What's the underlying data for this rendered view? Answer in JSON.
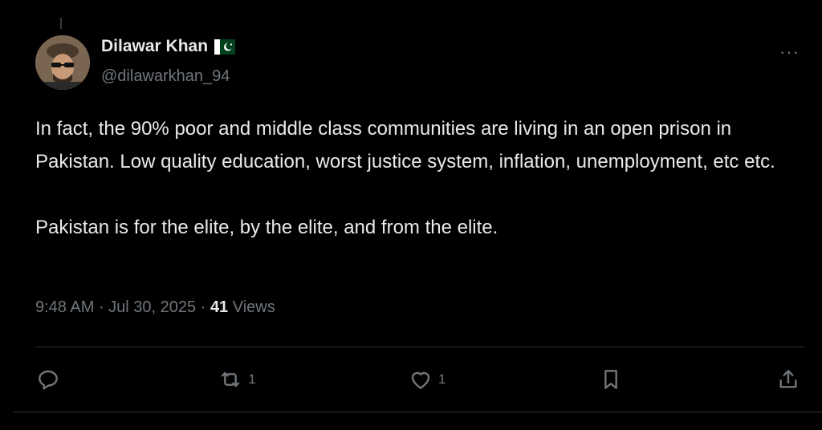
{
  "author": {
    "display_name": "Dilawar Khan",
    "flag": "pakistan-flag-icon",
    "handle": "@dilawarkhan_94"
  },
  "tweet": {
    "paragraphs": [
      "In fact, the 90% poor and middle class communities are living in an open prison in Pakistan. Low quality education, worst justice system, inflation, unemployment, etc etc.",
      "Pakistan is for the elite, by the elite, and from the elite."
    ],
    "time": "9:48 AM",
    "date": "Jul 30, 2025",
    "views_count": "41",
    "views_label": "Views"
  },
  "actions": {
    "reply_count": "",
    "retweet_count": "1",
    "like_count": "1"
  },
  "more_label": "···",
  "colors": {
    "background": "#000000",
    "text": "#e7e9ea",
    "muted": "#71767b",
    "divider": "#2f3336"
  }
}
